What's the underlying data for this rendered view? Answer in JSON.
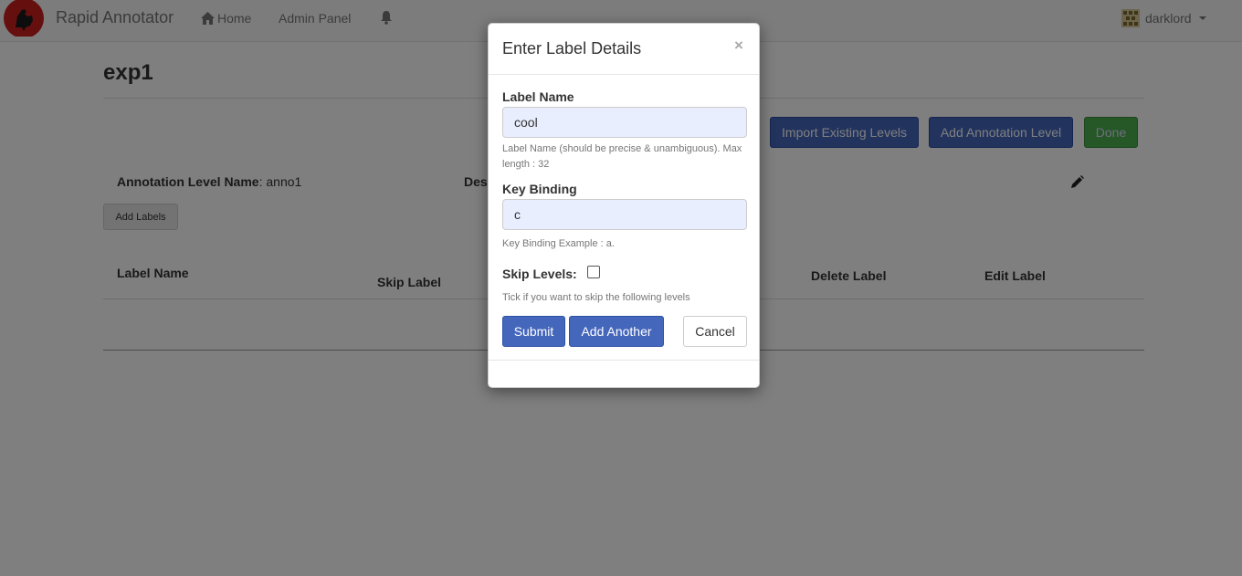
{
  "navbar": {
    "brand": "Rapid Annotator",
    "home": "Home",
    "admin": "Admin Panel",
    "user": "darklord",
    "icons": [
      "rooster-logo-icon",
      "home-icon",
      "bell-icon",
      "user-avatar-icon",
      "caret-down-icon"
    ]
  },
  "page": {
    "title": "exp1",
    "import_button": "Import Existing Levels",
    "add_level_button": "Add Annotation Level",
    "done_button": "Done",
    "level_name_label": "Annotation Level Name",
    "level_name_value": ": anno1",
    "description_label": "Des",
    "add_labels_button": "Add Labels",
    "table_headers": {
      "label_name": "Label Name",
      "skip_label": "Skip Label",
      "delete_label": "Delete Label",
      "edit_label": "Edit Label"
    }
  },
  "modal": {
    "title": "Enter Label Details",
    "close": "×",
    "label_name_title": "Label Name",
    "label_name_value": "cool",
    "label_name_help": "Label Name (should be precise & unambiguous). Max length : 32",
    "key_binding_title": "Key Binding",
    "key_binding_value": "c",
    "key_binding_help": "Key Binding Example : a.",
    "skip_levels_title": "Skip Levels:",
    "skip_levels_checked": false,
    "skip_levels_help": "Tick if you want to skip the following levels",
    "submit": "Submit",
    "add_another": "Add Another",
    "cancel": "Cancel"
  },
  "colors": {
    "primary": "#4466bb",
    "success": "#4cae4c",
    "input_bg": "#e8eefe"
  }
}
